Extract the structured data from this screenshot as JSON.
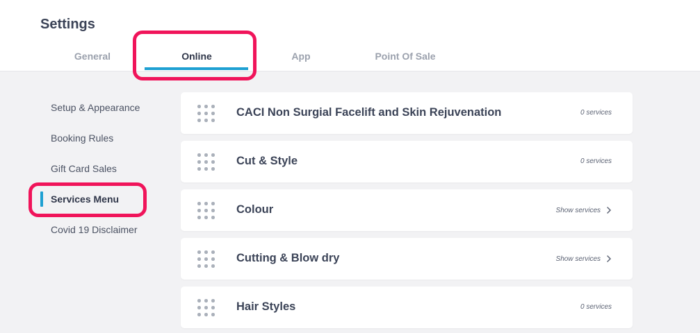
{
  "header": {
    "title": "Settings",
    "tabs": [
      {
        "label": "General"
      },
      {
        "label": "Online"
      },
      {
        "label": "App"
      },
      {
        "label": "Point Of Sale"
      }
    ]
  },
  "sidebar": {
    "items": [
      {
        "label": "Setup & Appearance"
      },
      {
        "label": "Booking Rules"
      },
      {
        "label": "Gift Card Sales"
      },
      {
        "label": "Services Menu"
      },
      {
        "label": "Covid 19 Disclaimer"
      }
    ]
  },
  "categories": [
    {
      "title": "CACI Non Surgial Facelift and Skin Rejuvenation",
      "meta": "0 services"
    },
    {
      "title": "Cut & Style",
      "meta": "0 services"
    },
    {
      "title": "Colour",
      "action": "Show services"
    },
    {
      "title": "Cutting & Blow dry",
      "action": "Show services"
    },
    {
      "title": "Hair Styles",
      "meta": "0 services"
    }
  ],
  "colors": {
    "accent": "#1ea0d2",
    "highlight": "#f0145a",
    "background": "#f2f2f4"
  },
  "icons": {
    "drag": "drag-handle-icon",
    "chevron": "chevron-right-icon"
  }
}
